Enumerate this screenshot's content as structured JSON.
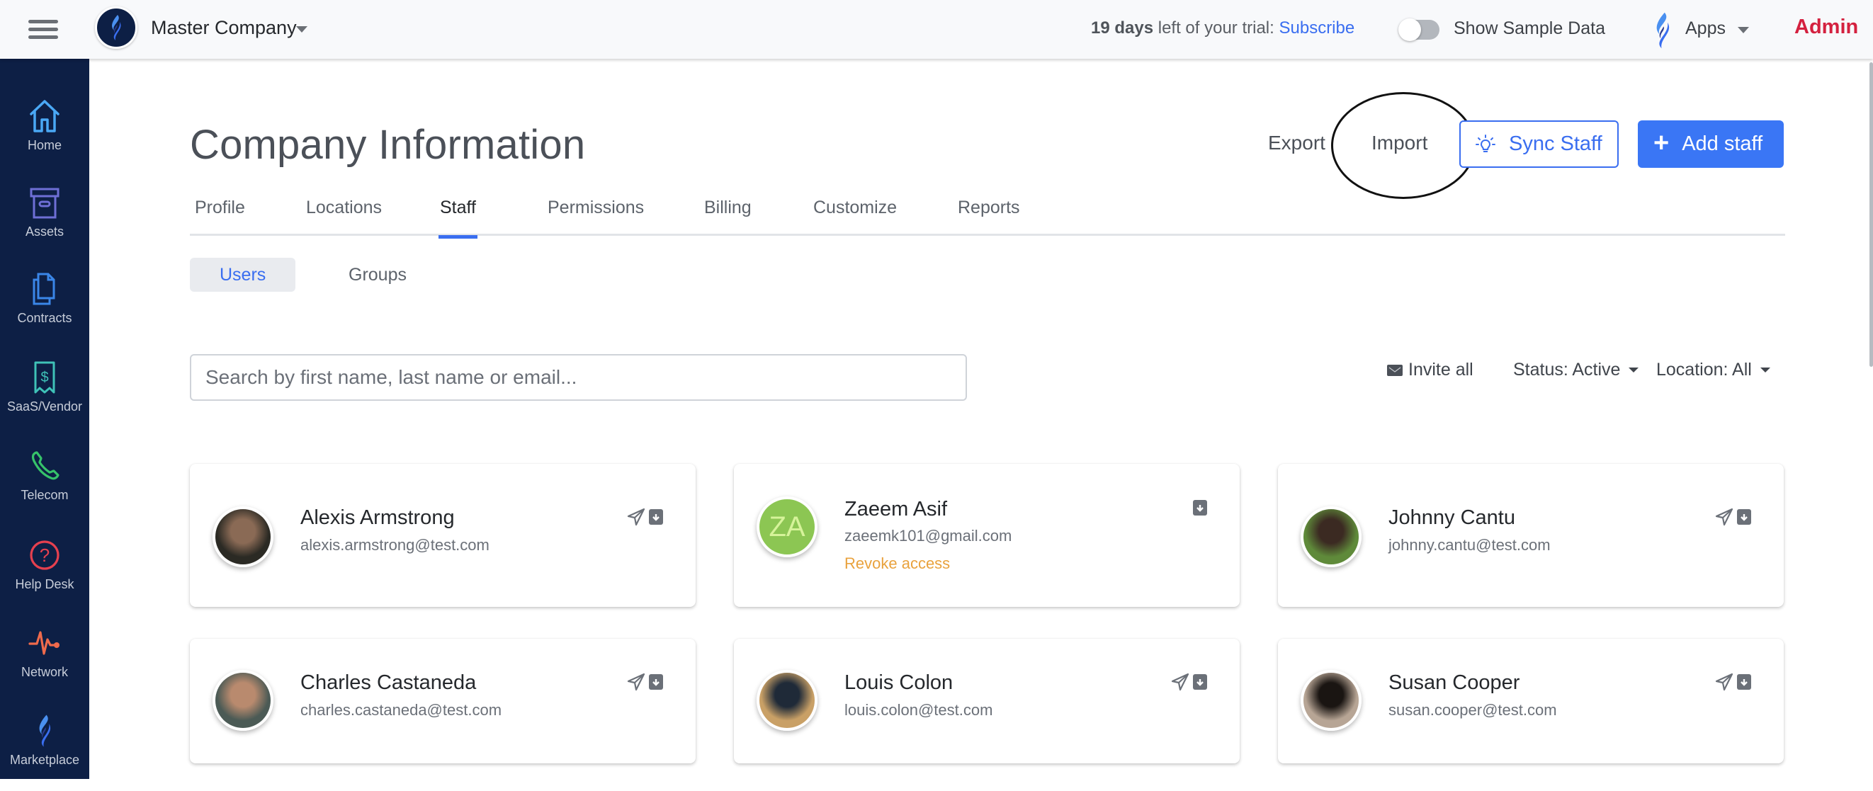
{
  "header": {
    "menu_icon": "hamburger-icon",
    "company_name": "Master Company",
    "trial_days": "19 days",
    "trial_text": " left of your trial: ",
    "subscribe_label": "Subscribe",
    "sample_data_label": "Show Sample Data",
    "sample_data_enabled": false,
    "apps_label": "Apps",
    "user_label": "Admin"
  },
  "sidebar": {
    "items": [
      {
        "label": "Home",
        "icon": "home-icon",
        "color": "#4aa8f5"
      },
      {
        "label": "Assets",
        "icon": "archive-box-icon",
        "color": "#6e6fd6"
      },
      {
        "label": "Contracts",
        "icon": "documents-icon",
        "color": "#3a86e8"
      },
      {
        "label": "SaaS/Vendor",
        "icon": "receipt-dollar-icon",
        "color": "#3fc2b8"
      },
      {
        "label": "Telecom",
        "icon": "phone-icon",
        "color": "#36c26a"
      },
      {
        "label": "Help Desk",
        "icon": "help-circle-icon",
        "color": "#e5404f"
      },
      {
        "label": "Network",
        "icon": "pulse-icon",
        "color": "#ef6a4c"
      },
      {
        "label": "Marketplace",
        "icon": "flame-logo-icon",
        "color": "#3a86e8"
      }
    ]
  },
  "page": {
    "title": "Company Information",
    "actions": {
      "export_label": "Export",
      "import_label": "Import",
      "sync_label": "Sync Staff",
      "add_label": "Add staff"
    },
    "tabs": [
      {
        "label": "Profile",
        "active": false
      },
      {
        "label": "Locations",
        "active": false
      },
      {
        "label": "Staff",
        "active": true
      },
      {
        "label": "Permissions",
        "active": false
      },
      {
        "label": "Billing",
        "active": false
      },
      {
        "label": "Customize",
        "active": false
      },
      {
        "label": "Reports",
        "active": false
      }
    ],
    "subtabs": [
      {
        "label": "Users",
        "active": true
      },
      {
        "label": "Groups",
        "active": false
      }
    ],
    "search": {
      "placeholder": "Search by first name, last name or email...",
      "value": ""
    },
    "filters": {
      "invite_all_label": "Invite all",
      "status_label": "Status: Active",
      "location_label": "Location: All"
    }
  },
  "staff": [
    {
      "name": "Alexis Armstrong",
      "email": "alexis.armstrong@test.com",
      "avatar": "photo",
      "avatar_colors": [
        "#2b2a24",
        "#8a6a55"
      ],
      "invite_icon": true,
      "archive_icon": true
    },
    {
      "name": "Zaeem Asif",
      "email": "zaeemk101@gmail.com",
      "avatar": "initials",
      "initials": "ZA",
      "revoke_label": "Revoke access",
      "invite_icon": false,
      "archive_icon": true
    },
    {
      "name": "Johnny Cantu",
      "email": "johnny.cantu@test.com",
      "avatar": "photo",
      "avatar_colors": [
        "#5f8a3a",
        "#3b2a22"
      ],
      "invite_icon": true,
      "archive_icon": true
    },
    {
      "name": "Charles Castaneda",
      "email": "charles.castaneda@test.com",
      "avatar": "photo",
      "avatar_colors": [
        "#4b5a55",
        "#b98a6e"
      ],
      "invite_icon": true,
      "archive_icon": true
    },
    {
      "name": "Louis Colon",
      "email": "louis.colon@test.com",
      "avatar": "photo",
      "avatar_colors": [
        "#c9a066",
        "#1f2a38"
      ],
      "invite_icon": true,
      "archive_icon": true
    },
    {
      "name": "Susan Cooper",
      "email": "susan.cooper@test.com",
      "avatar": "photo",
      "avatar_colors": [
        "#b7a595",
        "#1a1512"
      ],
      "invite_icon": true,
      "archive_icon": true
    }
  ],
  "annotation": {
    "circled_element": "Import"
  }
}
